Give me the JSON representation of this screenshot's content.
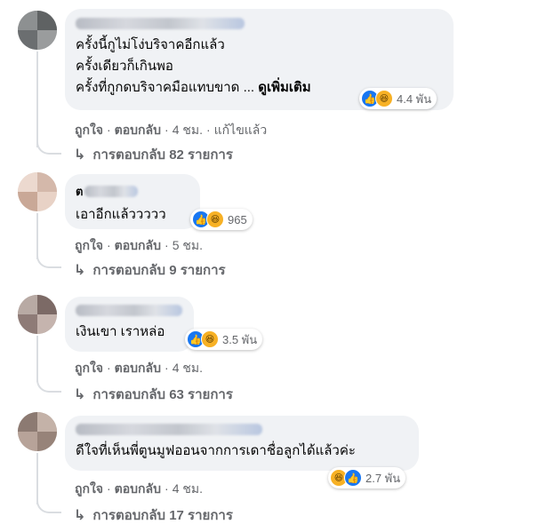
{
  "comments": [
    {
      "body": "ครั้งนี้กูไม่โง่บริจาคอีกแล้ว\nครั้งเดียวก็เกินพอ\nครั้งที่กูกดบริจาคมือแทบขาด ...",
      "see_more": "ดูเพิ่มเติม",
      "reaction_count": "4.4 พัน",
      "reaction_icons": [
        "like-icon",
        "haha-icon"
      ],
      "like_label": "ถูกใจ",
      "reply_label": "ตอบกลับ",
      "time": "4 ชม.",
      "edited": "แก้ไขแล้ว",
      "replies": "การตอบกลับ 82 รายการ"
    },
    {
      "name_prefix": "ต",
      "body": "เอาอีกแล้ววววว",
      "reaction_count": "965",
      "reaction_icons": [
        "like-icon",
        "haha-icon"
      ],
      "like_label": "ถูกใจ",
      "reply_label": "ตอบกลับ",
      "time": "5 ชม.",
      "replies": "การตอบกลับ 9 รายการ"
    },
    {
      "body": "เงินเขา เราหล่อ",
      "reaction_count": "3.5 พัน",
      "reaction_icons": [
        "like-icon",
        "haha-icon"
      ],
      "like_label": "ถูกใจ",
      "reply_label": "ตอบกลับ",
      "time": "4 ชม.",
      "replies": "การตอบกลับ 63 รายการ"
    },
    {
      "body": "ดีใจที่เห็นพี่ตูนมูฟออนจากการเดาชื่อลูกได้แล้วค่ะ",
      "reaction_count": "2.7 พัน",
      "reaction_icons": [
        "haha-icon",
        "like-icon"
      ],
      "like_label": "ถูกใจ",
      "reply_label": "ตอบกลับ",
      "time": "4 ชม.",
      "replies": "การตอบกลับ 17 รายการ"
    }
  ],
  "colors": {
    "bubble": "#f0f2f5",
    "meta": "#65676b",
    "like": "#1877f2",
    "haha": "#f7b125"
  }
}
